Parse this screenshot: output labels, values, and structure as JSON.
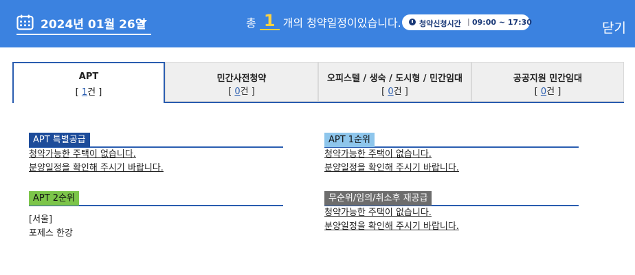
{
  "header": {
    "date_label": "2024년 01월 26일",
    "summary_prefix": "총",
    "summary_count": "1",
    "summary_suffix": "개의 청약일정이있습니다.",
    "time_label": "청약신청시간",
    "time_sep": "|",
    "time_range": "09:00 ~ 17:30",
    "close_label": "닫기"
  },
  "tabs": [
    {
      "label": "APT",
      "count_open": "[ ",
      "count": "1",
      "count_close": "건 ]",
      "active": true
    },
    {
      "label": "민간사전청약",
      "count_open": "[ ",
      "count": "0",
      "count_close": "건 ]",
      "active": false
    },
    {
      "label": "오피스텔 / 생숙 / 도시형 / 민간임대",
      "count_open": "[ ",
      "count": "0",
      "count_close": "건 ]",
      "active": false
    },
    {
      "label": "공공지원 민간임대",
      "count_open": "[ ",
      "count": "0",
      "count_close": "건 ]",
      "active": false
    }
  ],
  "sections": {
    "special": {
      "title": "APT 특별공급",
      "line1": "청약가능한 주택이 없습니다.",
      "line2": "분양일정을 확인해 주시기 바랍니다."
    },
    "first": {
      "title": "APT 1순위",
      "line1": "청약가능한 주택이 없습니다.",
      "line2": "분양일정을 확인해 주시기 바랍니다."
    },
    "second": {
      "title": "APT 2순위",
      "region": "[서울]",
      "item": "포제스 한강"
    },
    "remain": {
      "title": "무순위/임의/취소후 재공급",
      "line1": "청약가능한 주택이 없습니다.",
      "line2": "분양일정을 확인해 주시기 바랍니다."
    }
  },
  "colors": {
    "header_bg": "#3b82e0",
    "accent": "#2a5db0",
    "count_highlight": "#ffd23f",
    "badge_special": "#1d4c9a",
    "badge_first": "#8ec6ec",
    "badge_second": "#7cc54a",
    "badge_remain": "#6d6d6d"
  }
}
